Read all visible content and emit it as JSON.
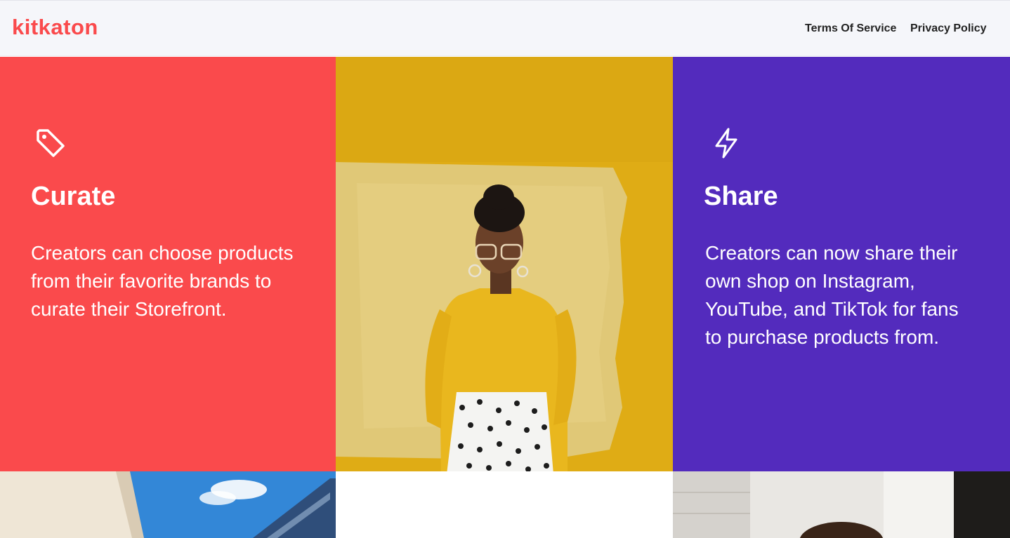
{
  "header": {
    "logo": "kitkaton",
    "nav": [
      {
        "label": "Terms Of Service"
      },
      {
        "label": "Privacy Policy"
      }
    ]
  },
  "features": {
    "curate": {
      "icon": "tag-icon",
      "title": "Curate",
      "text": "Creators can choose products from their favorite brands to curate their Storefront."
    },
    "share": {
      "icon": "lightning-icon",
      "title": "Share",
      "text": "Creators can now share their own shop on Instagram, YouTube, and TikTok for fans to purchase products from."
    }
  },
  "colors": {
    "brand_red": "#fa4a4c",
    "brand_purple": "#532bbd",
    "photo_yellow": "#e0ad16"
  }
}
